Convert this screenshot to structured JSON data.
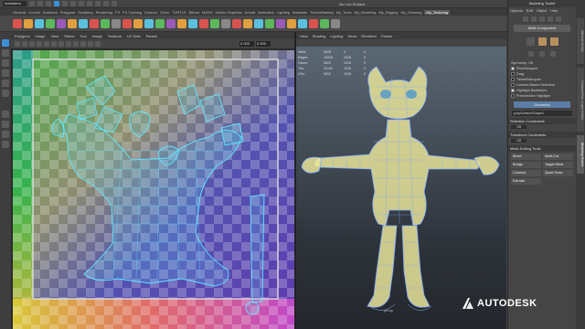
{
  "topbar": {
    "mode": "Animation",
    "field_hint": "No Live Surface"
  },
  "shelf_tabs": [
    "General",
    "Curves",
    "Surfaces",
    "Polygons",
    "Sculpting",
    "Rendering",
    "FX",
    "FX Caching",
    "Custom",
    "XGen",
    "TURTLE",
    "Bifrost",
    "MASH",
    "Motion Graphics",
    "Arnold",
    "Animation",
    "Lighting",
    "Materials",
    "TextureBaking",
    "My_Tools",
    "My_Modeling",
    "My_Rigging",
    "My_Skinning",
    "My_Texturing"
  ],
  "shelf_active": "My_Texturing",
  "uv_menu": [
    "Polygons",
    "Image",
    "View",
    "Select",
    "Tool",
    "Image",
    "Textures",
    "UV Sets",
    "Panels"
  ],
  "uv_fields": [
    "0.000",
    "0.000"
  ],
  "vp_menu": [
    "View",
    "Shading",
    "Lighting",
    "Show",
    "Renderer",
    "Panels"
  ],
  "hud": [
    {
      "label": "Verts:",
      "a": "5428",
      "b": "0",
      "c": "0"
    },
    {
      "label": "Edges:",
      "a": "10948",
      "b": "2416",
      "c": "0"
    },
    {
      "label": "Faces:",
      "a": "5520",
      "b": "1218",
      "c": "0"
    },
    {
      "label": "Tris:",
      "a": "11040",
      "b": "1316",
      "c": "0"
    },
    {
      "label": "UVs:",
      "a": "5812",
      "b": "1248",
      "c": "0"
    }
  ],
  "camera_label": "persp",
  "right_panel": {
    "title": "Modeling Toolkit",
    "menu": [
      "Options",
      "Edit",
      "Object",
      "Help"
    ],
    "multi_component": "Multi-Component",
    "symmetry_label": "Symmetry: Off",
    "checks": [
      {
        "label": "Pick/Marquee",
        "on": true
      },
      {
        "label": "Drag",
        "on": false
      },
      {
        "label": "Tweak/Marquee",
        "on": false
      },
      {
        "label": "Camera Based Selection",
        "on": false
      },
      {
        "label": "Highlight Backfaces",
        "on": true
      },
      {
        "label": "Preselection Highlight",
        "on": false
      }
    ],
    "geometry_btn": "Geometry",
    "object_name": "polySurfaceShape1",
    "sec_selection": "Selection Constraints",
    "constraint_value": "Off",
    "sec_transform": "Transform Constraints",
    "transform_value": "Off",
    "sec_mesh": "Mesh Editing Tools",
    "tools": [
      "Bevel",
      "Multi-Cut",
      "Bridge",
      "Target Weld",
      "Connect",
      "Quad Draw",
      "Extrude"
    ]
  },
  "vertical_tabs": [
    "Attribute Editor",
    "Channel Box / Layer Editor",
    "Modeling Toolkit"
  ],
  "logo_text": "AUTODESK",
  "colors": {
    "wire": "#5fe6ff",
    "accent": "#3d8fd6",
    "mesh_fill": "#e7e49a"
  }
}
